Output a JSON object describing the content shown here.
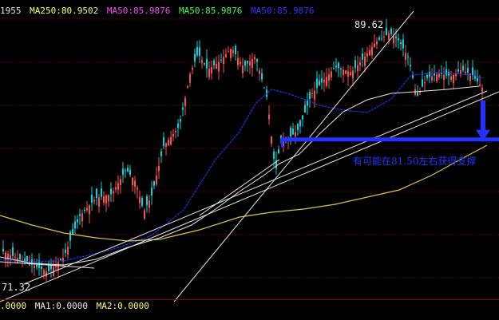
{
  "header_legend": [
    {
      "text": "1955",
      "color": "#e6e6e6"
    },
    {
      "text": "MA250:80.9502",
      "color": "#ffff66"
    },
    {
      "text": "MA50:85.9876",
      "color": "#ff44ff"
    },
    {
      "text": "MA50:85.9876",
      "color": "#44ff44"
    },
    {
      "text": "MA50:85.9876",
      "color": "#3333ff"
    }
  ],
  "footer_legend": [
    {
      "text": ".0000",
      "color": "#ffff66"
    },
    {
      "text": "MA1:0.0000",
      "color": "#e6e6e6"
    },
    {
      "text": "MA2:0.0000",
      "color": "#ffff66"
    }
  ],
  "high_label": "89.62",
  "low_label": "71.32",
  "annotation": "有可能在81.50左右获得支撑",
  "colors": {
    "up": "#ff4d4d",
    "down": "#00d8e0",
    "ma_blue": "#2233ff",
    "ma_yellow": "#d8c64a",
    "ma_white": "#e8e8e8",
    "grid": "#8a0000",
    "arrow": "#2233ff"
  },
  "chart_data": {
    "type": "candlestick",
    "ylim": [
      70.1,
      90.3
    ],
    "grid": true,
    "high": 89.62,
    "low": 71.32,
    "support_level": 81.5,
    "moving_averages": [
      "blue",
      "yellow",
      "white"
    ],
    "note": "有可能在81.50左右获得支撑"
  }
}
